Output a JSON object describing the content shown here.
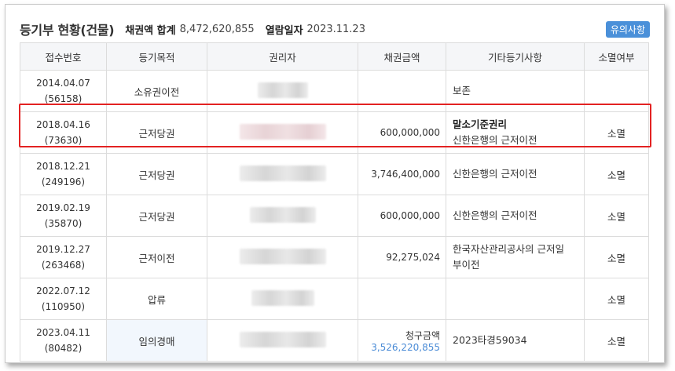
{
  "header": {
    "title": "등기부 현황(건물)",
    "total_label": "채권액 합계",
    "total_value": "8,472,620,855",
    "date_label": "열람일자",
    "date_value": "2023.11.23",
    "notice_button": "유의사항"
  },
  "table": {
    "columns": [
      "접수번호",
      "등기목적",
      "권리자",
      "채권금액",
      "기타등기사항",
      "소멸여부"
    ],
    "rows": [
      {
        "date": "2014.04.07",
        "number": "(56158)",
        "purpose": "소유권이전",
        "amount": "",
        "amount_label": "",
        "other_main": "보존",
        "other_sub": "",
        "status": ""
      },
      {
        "date": "2018.04.16",
        "number": "(73630)",
        "purpose": "근저당권",
        "amount": "600,000,000",
        "amount_label": "",
        "other_main": "말소기준권리",
        "other_sub": "신한은행의 근저이전",
        "status": "소멸"
      },
      {
        "date": "2018.12.21",
        "number": "(249196)",
        "purpose": "근저당권",
        "amount": "3,746,400,000",
        "amount_label": "",
        "other_main": "신한은행의 근저이전",
        "other_sub": "",
        "status": "소멸"
      },
      {
        "date": "2019.02.19",
        "number": "(35870)",
        "purpose": "근저당권",
        "amount": "600,000,000",
        "amount_label": "",
        "other_main": "신한은행의 근저이전",
        "other_sub": "",
        "status": "소멸"
      },
      {
        "date": "2019.12.27",
        "number": "(263468)",
        "purpose": "근저이전",
        "amount": "92,275,024",
        "amount_label": "",
        "other_main": "한국자산관리공사의 근저일",
        "other_sub": "부이전",
        "status": "소멸"
      },
      {
        "date": "2022.07.12",
        "number": "(110950)",
        "purpose": "압류",
        "amount": "",
        "amount_label": "",
        "other_main": "",
        "other_sub": "",
        "status": "소멸"
      },
      {
        "date": "2023.04.11",
        "number": "(80482)",
        "purpose": "임의경매",
        "amount": "3,526,220,855",
        "amount_label": "청구금액",
        "other_main": "2023타경59034",
        "other_sub": "",
        "status": "소멸"
      }
    ]
  },
  "colors": {
    "accent": "#4a90d9",
    "highlight_border": "#e32222",
    "header_bg": "#f5f6f8",
    "link_amount": "#4a8bd6"
  }
}
